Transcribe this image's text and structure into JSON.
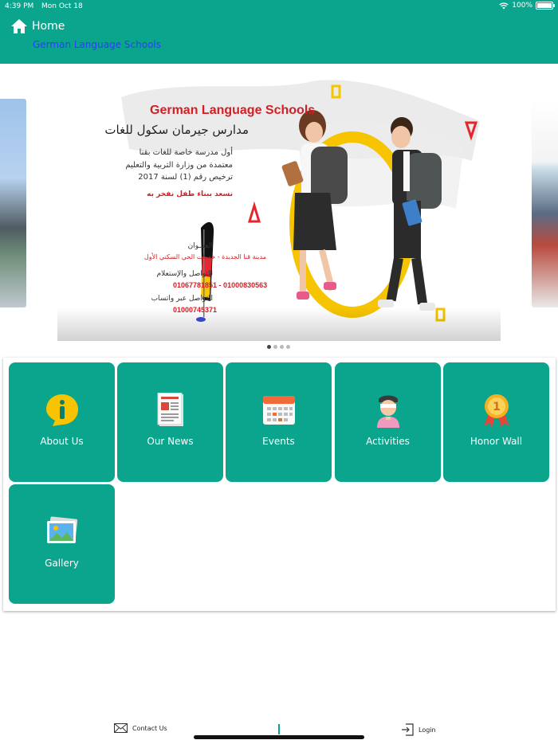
{
  "status_bar": {
    "time": "4:39 PM",
    "date": "Mon Oct 18",
    "battery": "100%",
    "battery_level": 1.0
  },
  "header": {
    "title": "Home",
    "subtitle": "German Language Schools"
  },
  "banner": {
    "title_en": "German Language Schools",
    "title_ar": "مدارس جيرمان سكول للغات",
    "line1": "أول مدرسة خاصة للغات بقنا",
    "line2": "معتمدة من وزارة التربية والتعليم",
    "line3": "ترخيص رقم (1) لسنة 2017",
    "slogan": "نسعد ببناء طفل نفخر به",
    "address_label": "العنــوان",
    "address": "مدينة قنا الجديدة - خدمات الحي السكني الأول",
    "contact_label": "للتواصل والإستعلام",
    "phones": "01067781851 - 01000830563",
    "whatsapp_label": "للتواصل عبر واتساب",
    "whatsapp": "01000745371"
  },
  "carousel": {
    "pages": 4,
    "active": 0
  },
  "menu": [
    {
      "label": "About Us",
      "icon": "info-icon"
    },
    {
      "label": "Our News",
      "icon": "newspaper-icon"
    },
    {
      "label": "Events",
      "icon": "calendar-icon"
    },
    {
      "label": "Activities",
      "icon": "student-icon"
    },
    {
      "label": "Honor Wall",
      "icon": "medal-icon"
    },
    {
      "label": "Gallery",
      "icon": "picture-icon"
    }
  ],
  "footer": {
    "contact_label": "Contact Us",
    "login_label": "Login"
  },
  "colors": {
    "accent": "#0aa58c",
    "link": "#2f3cff",
    "banner_red": "#d11f26"
  }
}
